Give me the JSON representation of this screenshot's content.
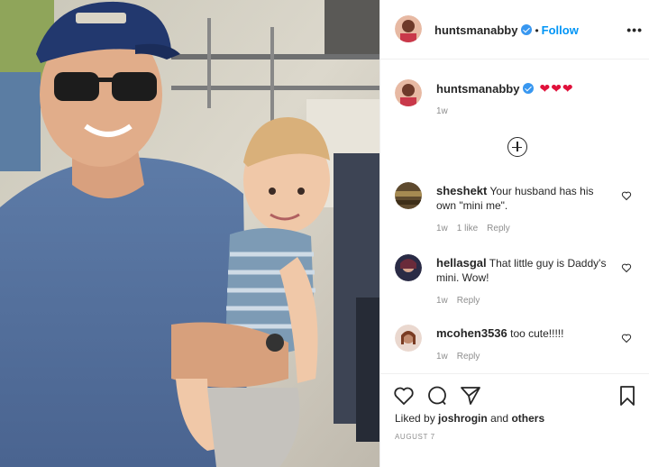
{
  "post": {
    "author": "huntsmanabby",
    "follow_label": "Follow",
    "dot": "•",
    "more_label": "•••",
    "caption_text": "❤❤❤",
    "caption_time": "1w",
    "likes_prefix": "Liked by",
    "liked_by_user": "joshrogin",
    "likes_and": "and",
    "likes_others": "others",
    "date": "AUGUST 7"
  },
  "comments": [
    {
      "user": "sheshekt",
      "text": "Your husband has his own \"mini me\".",
      "time": "1w",
      "likes": "1 like",
      "reply": "Reply"
    },
    {
      "user": "hellasgal",
      "text": "That little guy is Daddy's mini. Wow!",
      "time": "1w",
      "reply": "Reply"
    },
    {
      "user": "mcohen3536",
      "text": "too cute!!!!!",
      "time": "1w",
      "reply": "Reply"
    }
  ],
  "icons": {
    "verified": "verified-badge-icon",
    "load_more": "plus-circle-icon",
    "like": "heart-outline-icon",
    "comment": "comment-icon",
    "share": "paper-plane-icon",
    "save": "bookmark-icon"
  },
  "colors": {
    "accent": "#0095f6",
    "verified": "#3897f0",
    "heart": "#e0113b",
    "muted": "#8e8e8e"
  }
}
